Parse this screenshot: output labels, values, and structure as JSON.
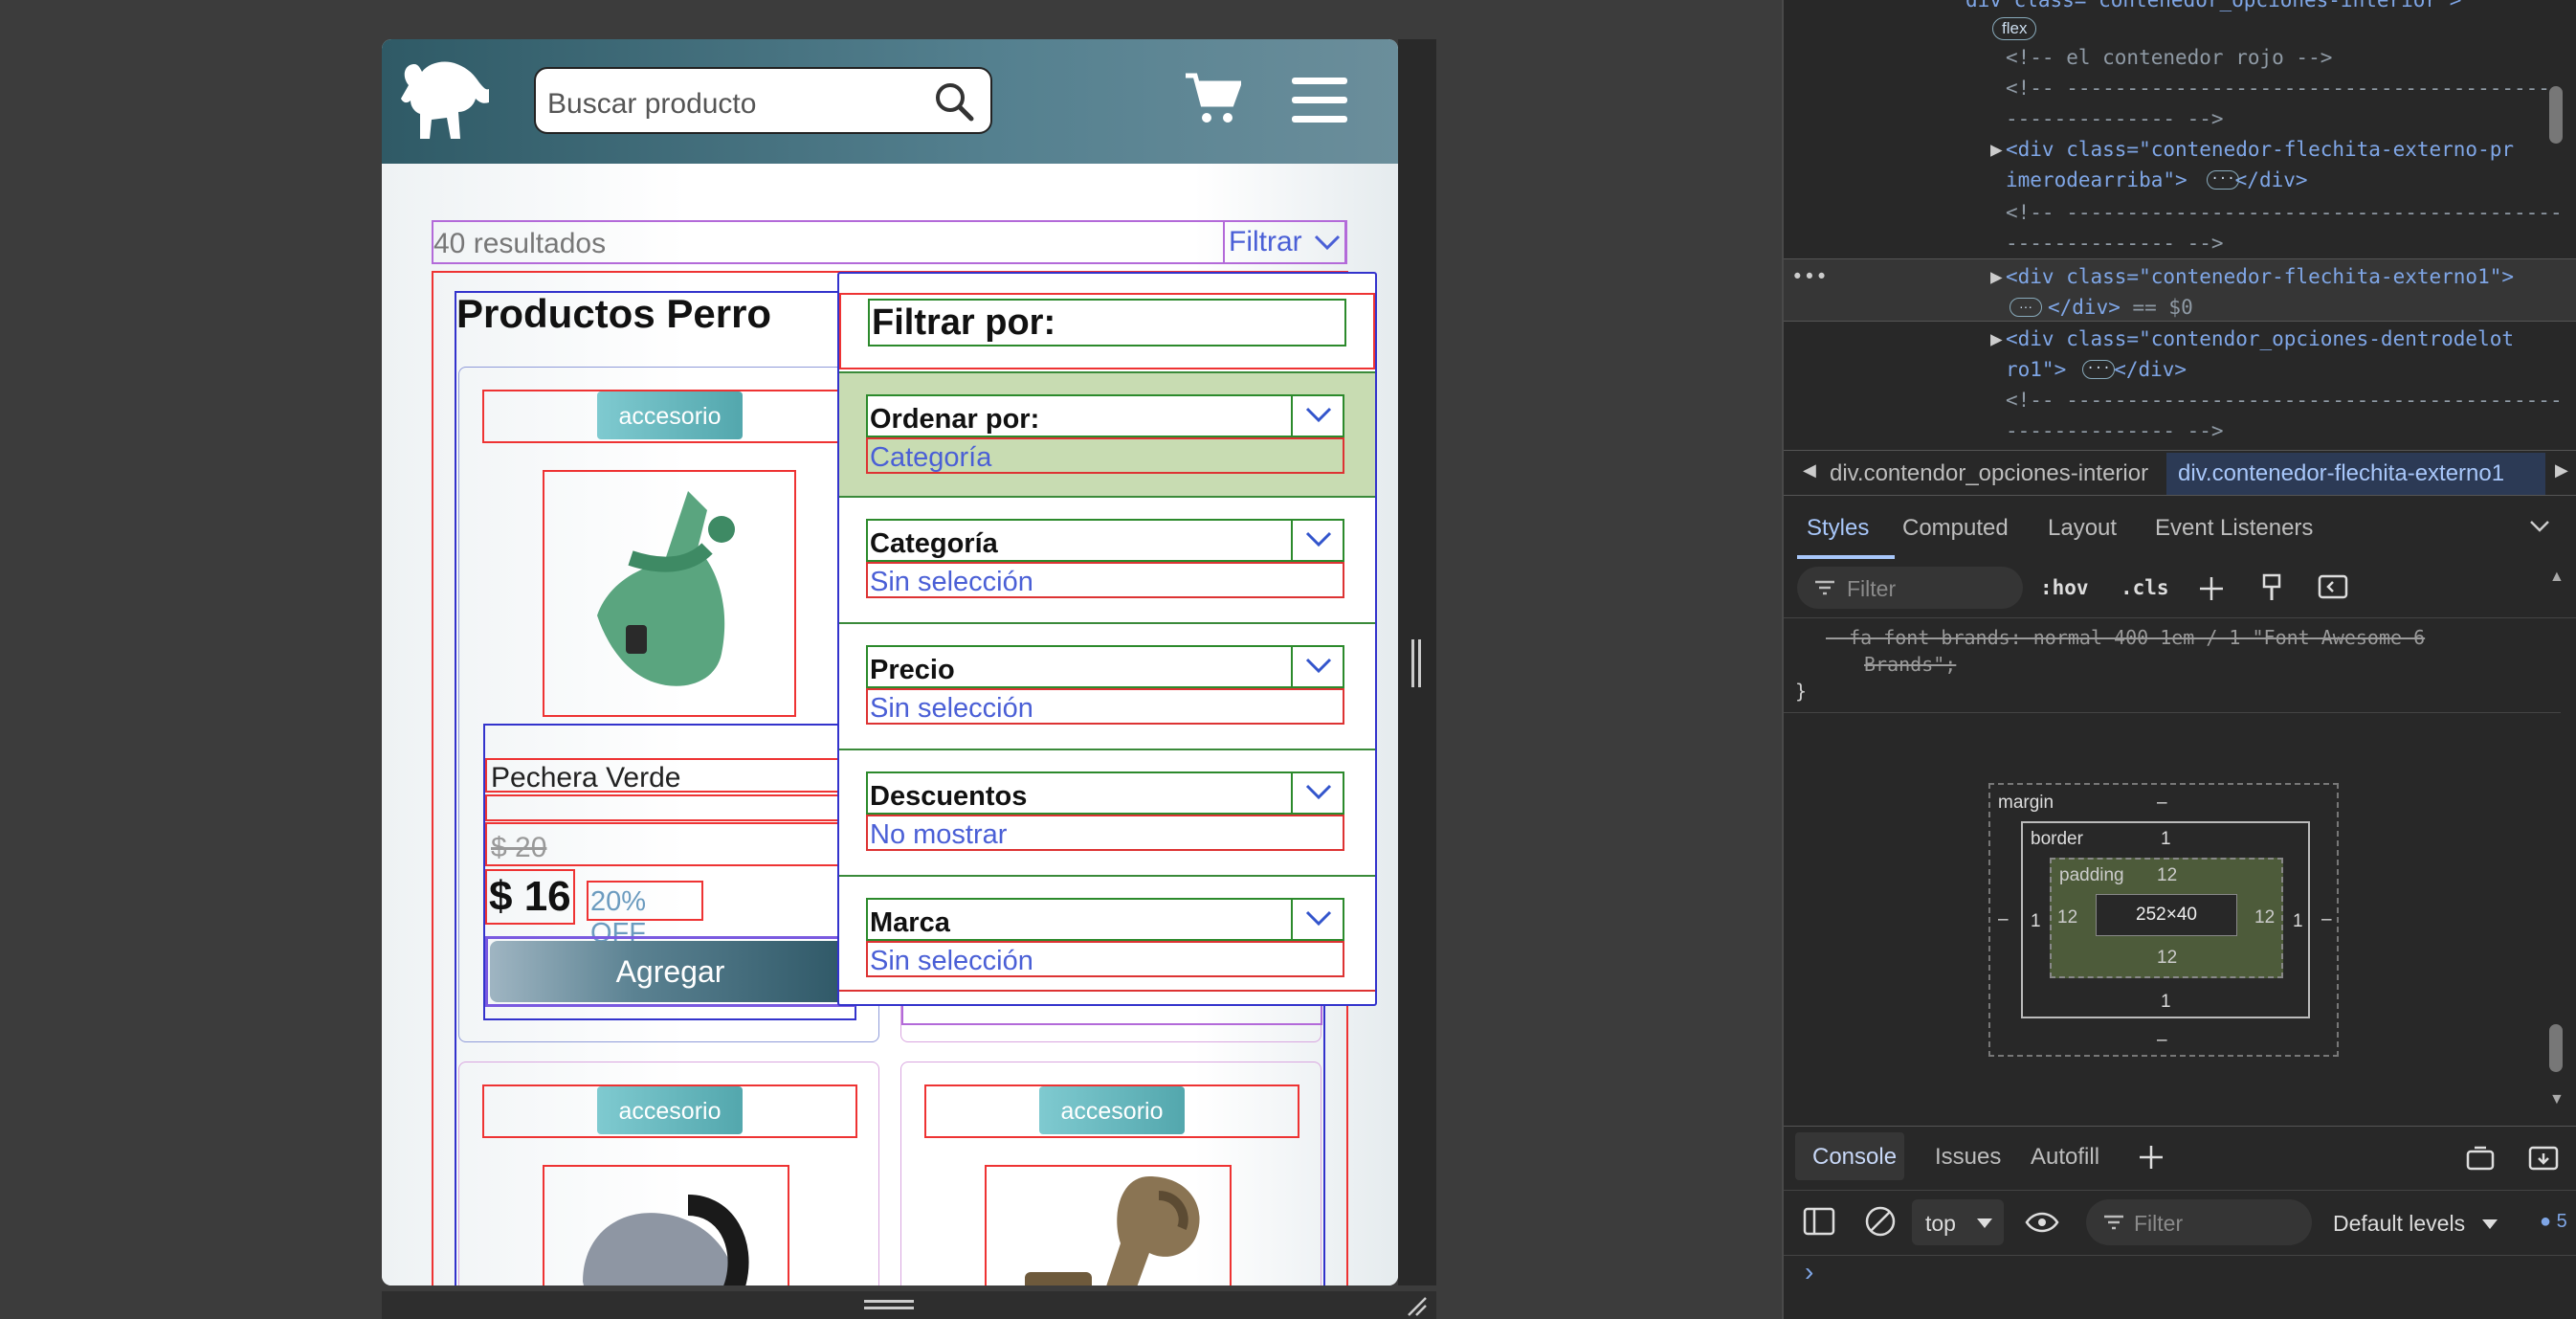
{
  "app": {
    "search_placeholder": "Buscar producto",
    "results_text": "40 resultados",
    "filter_button": "Filtrar",
    "section_title": "Productos Perro",
    "products": [
      {
        "tag": "accesorio",
        "name": "Pechera Verde",
        "old_price": "$ 20",
        "price": "$ 16",
        "discount": "20% OFF",
        "button": "Agregar"
      },
      {
        "tag": "accesorio"
      },
      {
        "tag": "accesorio"
      }
    ],
    "filter_panel": {
      "title": "Filtrar por:",
      "rows": [
        {
          "label": "Ordenar por:",
          "value": "Categoría"
        },
        {
          "label": "Categoría",
          "value": "Sin selección"
        },
        {
          "label": "Precio",
          "value": "Sin selección"
        },
        {
          "label": "Descuentos",
          "value": "No mostrar"
        },
        {
          "label": "Marca",
          "value": "Sin selección"
        }
      ]
    }
  },
  "devtools": {
    "elements": {
      "flex_badge": "flex",
      "line0": "div class=\"contenedor_opciones-interior\">",
      "line1": "<!-- el contenedor rojo -->",
      "line2": "<!-- -----------------------------------------",
      "line3": "-------------- -->",
      "line4a": "<div class=\"contenedor-flechita-externo-pr",
      "line4b": "imerodearriba\">",
      "line4c": "</div>",
      "line5": "<!-- -----------------------------------------",
      "line6": "-------------- -->",
      "line7": "<div class=\"contenedor-flechita-externo1\">",
      "line8a": "</div>",
      "line8b": " == $0",
      "line9a": "<div class=\"contendor_opciones-dentrodelot",
      "line9b": "ro1\">",
      "line9c": "</div>",
      "line10": "<!-- -----------------------------------------",
      "line11": "-------------- -->"
    },
    "breadcrumbs": [
      "div.contendor_opciones-interior",
      "div.contenedor-flechita-externo1"
    ],
    "tabs": [
      "Styles",
      "Computed",
      "Layout",
      "Event Listeners"
    ],
    "filter_placeholder": "Filter",
    "hov": ":hov",
    "cls": ".cls",
    "css_line1": "--fa-font-brands: normal 400 1em / 1 \"Font Awesome 6",
    "css_line2": "Brands\";",
    "css_brace": "}",
    "boxmodel": {
      "margin_label": "margin",
      "border_label": "border",
      "padding_label": "padding",
      "margin": "–",
      "border": "1",
      "padding": "12",
      "content": "252×40"
    },
    "drawer_tabs": [
      "Console",
      "Issues",
      "Autofill"
    ],
    "context": "top",
    "console_filter": "Filter",
    "levels": "Default levels",
    "issues_count": "5",
    "prompt": "›"
  }
}
